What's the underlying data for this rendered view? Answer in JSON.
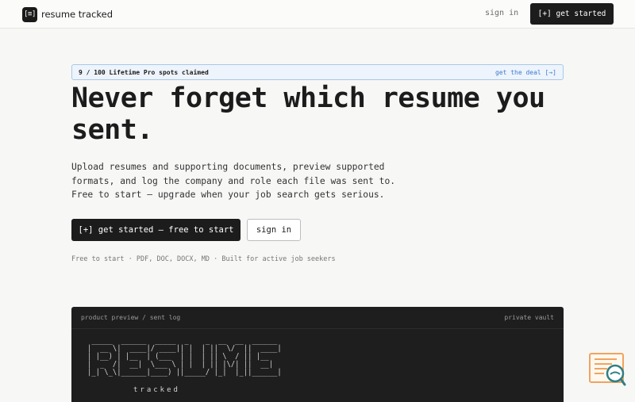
{
  "nav": {
    "brand_logo": "[≡]",
    "brand_name": "resume tracked",
    "sign_in": "sign in",
    "get_started": "[+] get started"
  },
  "banner": {
    "text": "9 / 100 Lifetime Pro spots claimed",
    "link": "get the deal [→]"
  },
  "hero": {
    "headline": "Never forget which resume you sent.",
    "lead": "Upload resumes and supporting documents, preview supported formats, and log the company and role each file was sent to. Free to start — upgrade when your job search gets serious.",
    "cta_primary": "[+] get started — free to start",
    "cta_secondary": "sign in",
    "meta": "Free to start · PDF, DOC, DOCX, MD · Built for active job seekers"
  },
  "preview": {
    "breadcrumb": "product preview / sent log",
    "tag": "private vault",
    "ascii_art": " _____  ______  _____  _    _  __  __  ______ \n|  __ \\|  ____|/ ____|| |  | ||  \\/  ||  ____|\n| |__) | |__  | (___  | |  | || \\  / || |__   \n|  _  /|  __|  \\___ \\ | |  | || |\\/| ||  __|  \n|_| \\_\\|______|____) ||_____/ |_|  |_||______|",
    "subtitle": "tracked"
  },
  "colors": {
    "accent_link": "#3a7bd5",
    "banner_bg": "#eef4fb",
    "banner_border": "#a9c7ea",
    "primary": "#1c1c1c",
    "widget_orange": "#f0a35e",
    "widget_teal": "#2f7f86"
  },
  "icons": {
    "brand": "document-brackets-icon",
    "help_widget": "search-document-icon"
  }
}
